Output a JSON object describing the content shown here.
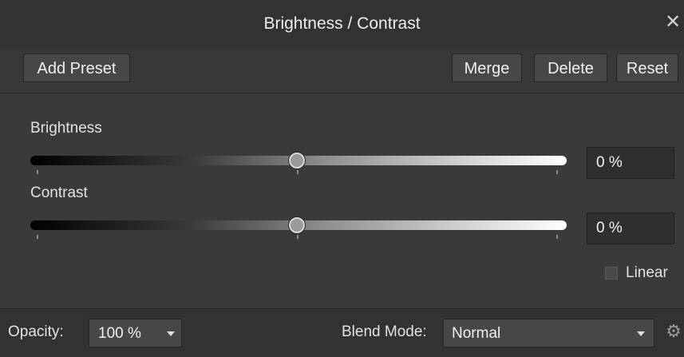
{
  "window": {
    "title": "Brightness / Contrast"
  },
  "toolbar": {
    "add_preset": "Add Preset",
    "merge": "Merge",
    "delete": "Delete",
    "reset": "Reset"
  },
  "adjustments": {
    "brightness": {
      "label": "Brightness",
      "value_text": "0 %",
      "value": 0
    },
    "contrast": {
      "label": "Contrast",
      "value_text": "0 %",
      "value": 0
    }
  },
  "linear": {
    "label": "Linear",
    "checked": false
  },
  "footer": {
    "opacity_label": "Opacity:",
    "opacity_value": "100 %",
    "blend_mode_label": "Blend Mode:",
    "blend_mode_value": "Normal"
  },
  "icons": {
    "close": "close-icon",
    "dropdown": "chevron-down-icon",
    "settings": "gear-icon"
  }
}
